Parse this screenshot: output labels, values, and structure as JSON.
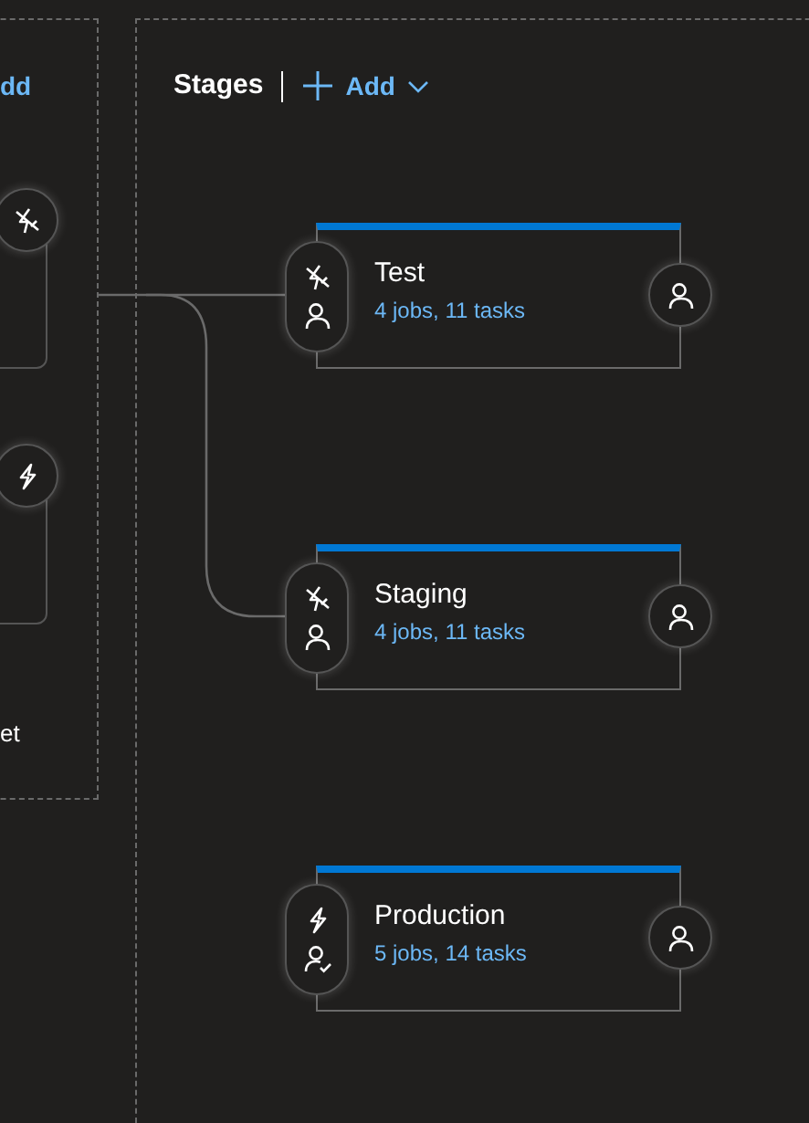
{
  "left_panel": {
    "add_label": "dd",
    "cards": [
      {
        "manual_trigger": true
      },
      {
        "manual_trigger": false
      }
    ],
    "footer_text": "et"
  },
  "stages_panel": {
    "title": "Stages",
    "add_button": "Add",
    "stages": [
      {
        "name": "Test",
        "summary": "4 jobs, 11 tasks",
        "manual_trigger": true,
        "approval_done": false,
        "connected": true
      },
      {
        "name": "Staging",
        "summary": "4 jobs, 11 tasks",
        "manual_trigger": true,
        "approval_done": false,
        "connected": true
      },
      {
        "name": "Production",
        "summary": "5 jobs, 14 tasks",
        "manual_trigger": false,
        "approval_done": true,
        "connected": false
      }
    ]
  }
}
